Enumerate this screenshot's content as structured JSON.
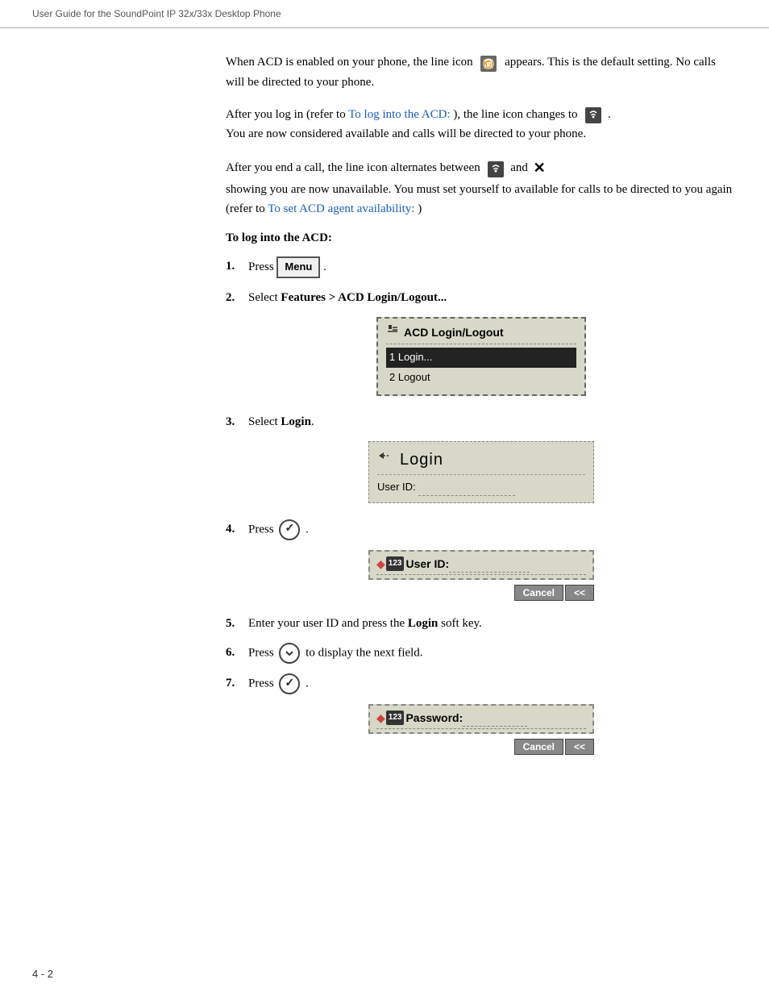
{
  "header": {
    "text": "User Guide for the SoundPoint IP 32x/33x Desktop Phone"
  },
  "paragraphs": {
    "p1": "When ACD is enabled on your phone, the line icon",
    "p1b": "appears. This is the default setting. No calls will be directed to your phone.",
    "p2a": "After you log in (refer to",
    "p2_link": "To log into the ACD:",
    "p2b": "), the line icon changes to",
    "p2c": "You are now considered available and calls will be directed to your phone.",
    "p3a": "After you end a call, the line icon alternates between",
    "p3_and": "and",
    "p3b": "showing you are now unavailable. You must set yourself to available for calls to be directed to you again (refer to",
    "p3_link": "To set ACD agent availability:",
    "p3c": ")"
  },
  "section_heading": "To log into the ACD:",
  "steps": [
    {
      "num": "1.",
      "text_before": "Press",
      "key": "Menu",
      "text_after": "."
    },
    {
      "num": "2.",
      "text": "Select",
      "bold": "Features > ACD Login/Logout..."
    },
    {
      "num": "3.",
      "text": "Select",
      "bold": "Login"
    },
    {
      "num": "4.",
      "text_before": "Press",
      "circle": "check",
      "text_after": "."
    },
    {
      "num": "5.",
      "text_before": "Enter your user ID and press the",
      "bold": "Login",
      "text_after": "soft key."
    },
    {
      "num": "6.",
      "text_before": "Press",
      "circle": "down",
      "text_after": "to display the next field."
    },
    {
      "num": "7.",
      "text_before": "Press",
      "circle": "check",
      "text_after": "."
    }
  ],
  "screens": {
    "acd_menu": {
      "title": "ACD Login/Logout",
      "item1": "1 Login...",
      "item2": "2 Logout"
    },
    "login_screen": {
      "title": "Login",
      "field": "User ID:"
    },
    "userid_screen": {
      "prefix_label": "123",
      "field_label": "User ID:"
    },
    "softkeys1": {
      "cancel": "Cancel",
      "back": "<<"
    },
    "password_screen": {
      "prefix_label": "123",
      "field_label": "Password:"
    },
    "softkeys2": {
      "cancel": "Cancel",
      "back": "<<"
    }
  },
  "footer": {
    "page_num": "4 - 2"
  }
}
